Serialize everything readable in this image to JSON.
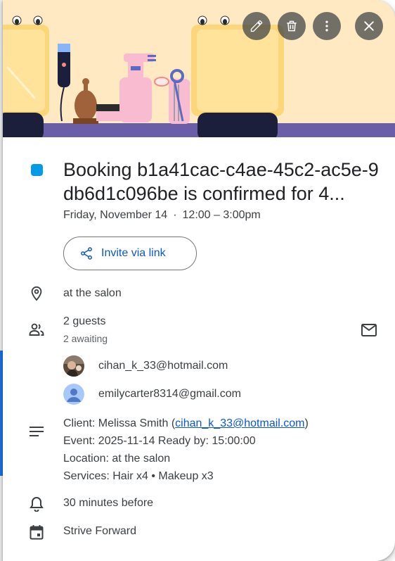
{
  "event": {
    "title": "Booking b1a41cac-c4ae-45c2-ac5e-9db6d1c096be is confirmed for 4...",
    "date": "Friday, November 14",
    "separator": "·",
    "time": "12:00 – 3:00pm",
    "calendar_color": "#039be5"
  },
  "actions": {
    "edit_icon": "pencil-icon",
    "delete_icon": "trash-icon",
    "more_icon": "more-vert-icon",
    "close_icon": "close-icon"
  },
  "invite": {
    "label": "Invite via link",
    "icon": "share-icon"
  },
  "location": {
    "text": "at the salon",
    "icon": "location-pin-icon"
  },
  "guests": {
    "count_label": "2 guests",
    "status_label": "2 awaiting",
    "icon": "people-icon",
    "email_icon": "mail-icon",
    "list": [
      {
        "email": "cihan_k_33@hotmail.com",
        "avatar": "photo-avatar"
      },
      {
        "email": "emilycarter8314@gmail.com",
        "avatar": "default-avatar"
      }
    ]
  },
  "description": {
    "icon": "notes-icon",
    "client_prefix": "Client: Melissa Smith (",
    "client_link": "cihan_k_33@hotmail.com",
    "client_suffix": ")",
    "event_line": "Event: 2025-11-14 Ready by: 15:00:00",
    "location_line": "Location: at the salon",
    "services_line": "Services: Hair x4 • Makeup x3"
  },
  "reminder": {
    "text": "30 minutes before",
    "icon": "bell-icon"
  },
  "calendar": {
    "text": "Strive Forward",
    "icon": "calendar-icon"
  }
}
